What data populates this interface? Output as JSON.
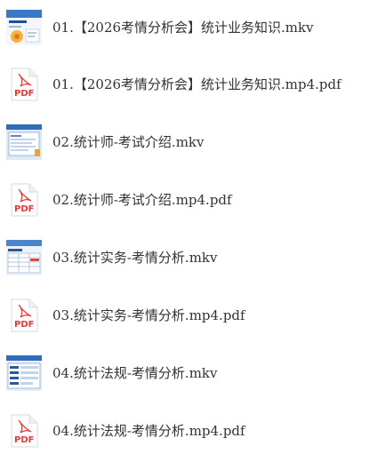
{
  "colors": {
    "text": "#333333",
    "pdf_accent": "#e53935",
    "pdf_paper": "#ffffff"
  },
  "files": [
    {
      "name": "01.【2026考情分析会】统计业务知识.mkv",
      "type": "video",
      "thumb_icon": "video-thumbnail-icon"
    },
    {
      "name": "01.【2026考情分析会】统计业务知识.mp4.pdf",
      "type": "pdf",
      "thumb_icon": "pdf-file-icon",
      "badge": "PDF"
    },
    {
      "name": "02.统计师-考试介绍.mkv",
      "type": "video",
      "thumb_icon": "video-thumbnail-icon"
    },
    {
      "name": "02.统计师-考试介绍.mp4.pdf",
      "type": "pdf",
      "thumb_icon": "pdf-file-icon",
      "badge": "PDF"
    },
    {
      "name": "03.统计实务-考情分析.mkv",
      "type": "video",
      "thumb_icon": "video-thumbnail-icon"
    },
    {
      "name": "03.统计实务-考情分析.mp4.pdf",
      "type": "pdf",
      "thumb_icon": "pdf-file-icon",
      "badge": "PDF"
    },
    {
      "name": "04.统计法规-考情分析.mkv",
      "type": "video",
      "thumb_icon": "video-thumbnail-icon"
    },
    {
      "name": "04.统计法规-考情分析.mp4.pdf",
      "type": "pdf",
      "thumb_icon": "pdf-file-icon",
      "badge": "PDF"
    }
  ]
}
